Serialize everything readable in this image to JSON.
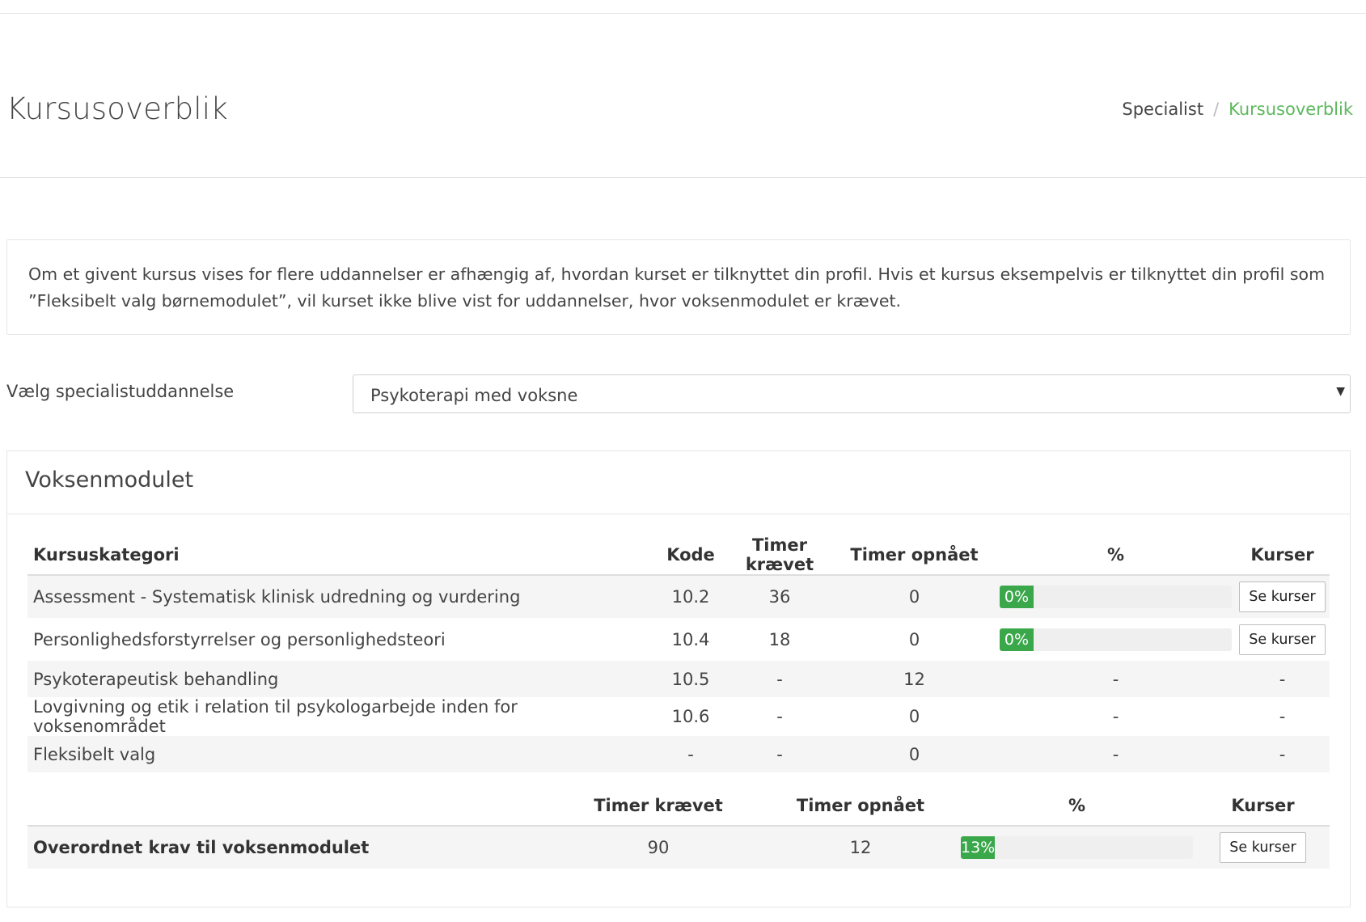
{
  "header": {
    "title": "Kursusoverblik",
    "breadcrumb": [
      "Specialist",
      "Kursusoverblik"
    ],
    "breadcrumb_separator": "/"
  },
  "info": {
    "text": "Om et givent kursus vises for flere uddannelser er afhængig af, hvordan kurset er tilknyttet din profil. Hvis et kursus eksempelvis er tilknyttet din profil som ”Fleksibelt valg børnemodulet”, vil kurset ikke blive vist for uddannelser, hvor voksenmodulet er krævet."
  },
  "select": {
    "label": "Vælg specialistuddannelse",
    "value": "Psykoterapi med voksne",
    "caret_icon": "caret-down-icon"
  },
  "module": {
    "title": "Voksenmodulet",
    "columns": [
      "Kursuskategori",
      "Kode",
      "Timer krævet",
      "Timer opnået",
      "%",
      "Kurser"
    ],
    "rows": [
      {
        "category": "Assessment - Systematisk klinisk udredning og vurdering",
        "code": "10.2",
        "required": "36",
        "achieved": "0",
        "percent": 0,
        "percent_label": "0%",
        "button": "Se kurser"
      },
      {
        "category": "Personlighedsforstyrrelser og personlighedsteori",
        "code": "10.4",
        "required": "18",
        "achieved": "0",
        "percent": 0,
        "percent_label": "0%",
        "button": "Se kurser"
      },
      {
        "category": "Psykoterapeutisk behandling",
        "code": "10.5",
        "required": "-",
        "achieved": "12",
        "percent_text": "-",
        "courses_text": "-"
      },
      {
        "category": "Lovgivning og etik i relation til psykologarbejde inden for voksenområdet",
        "code": "10.6",
        "required": "-",
        "achieved": "0",
        "percent_text": "-",
        "courses_text": "-"
      },
      {
        "category": "Fleksibelt valg",
        "code": "-",
        "required": "-",
        "achieved": "0",
        "percent_text": "-",
        "courses_text": "-"
      }
    ],
    "summary": {
      "columns": [
        "",
        "Timer krævet",
        "Timer opnået",
        "%",
        "Kurser"
      ],
      "label": "Overordnet krav til voksenmodulet",
      "required": "90",
      "achieved": "12",
      "percent": 13,
      "percent_label": "13%",
      "button": "Se kurser"
    }
  },
  "colors": {
    "accent": "#5cb85c",
    "progress_fill": "#3aa84a",
    "progress_track": "#efefef",
    "stripe": "#f5f5f5"
  }
}
